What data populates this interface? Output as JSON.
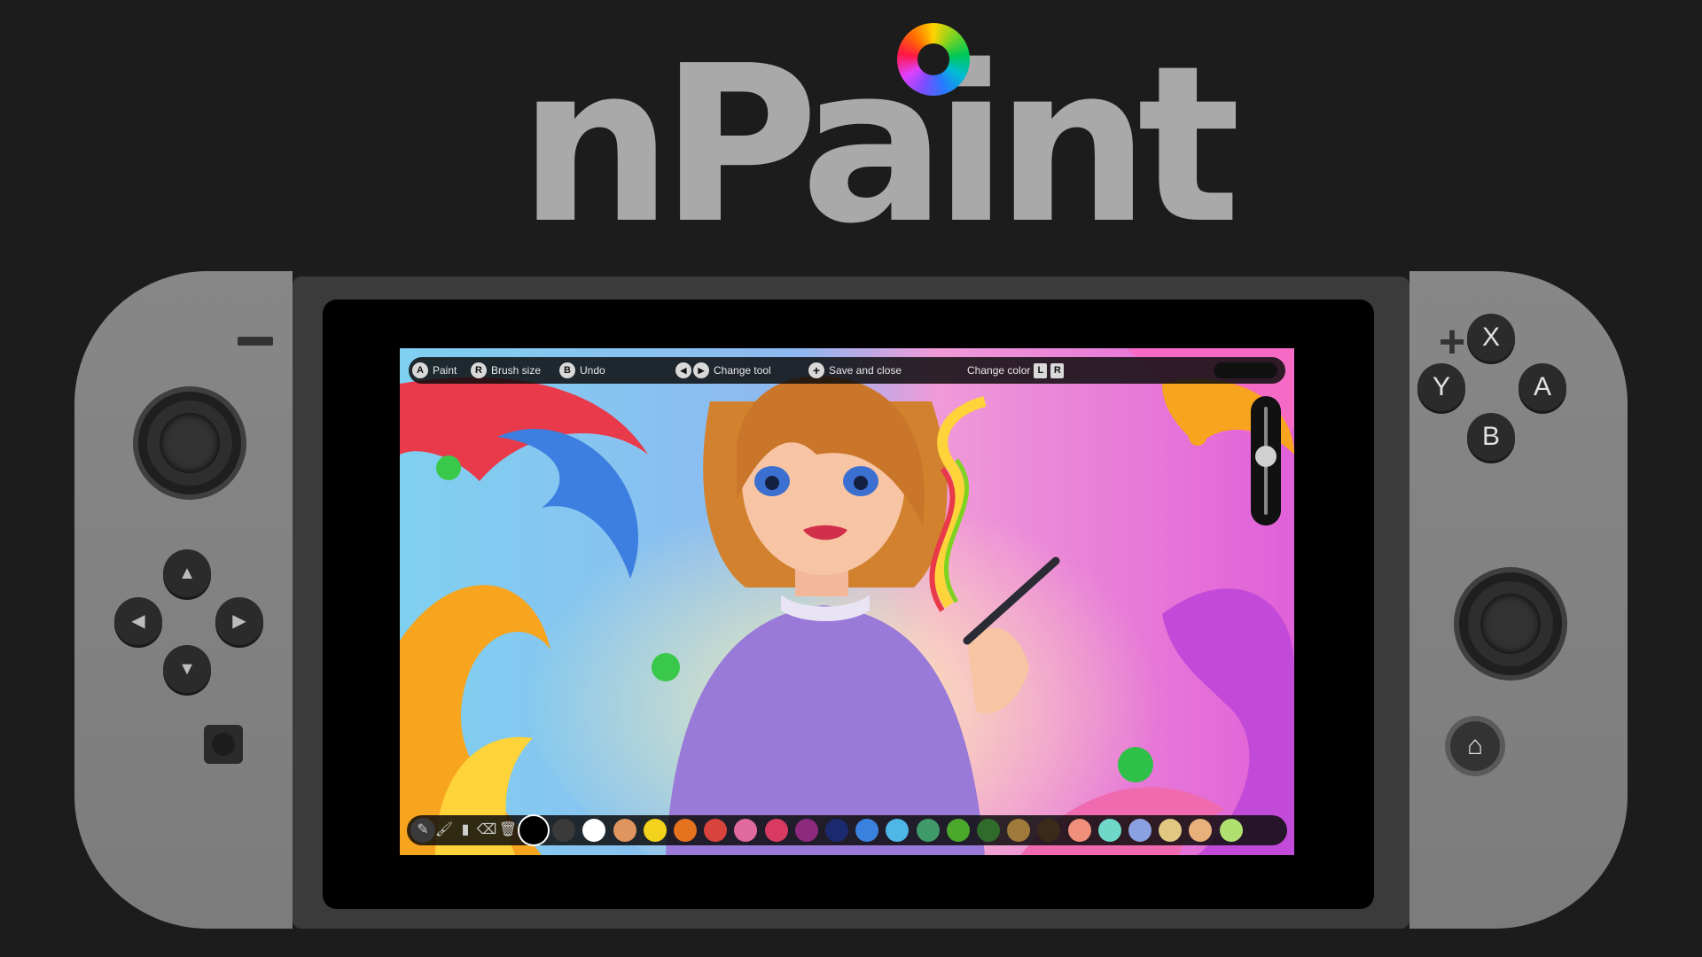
{
  "logo": {
    "text": "nPaint"
  },
  "topbar": {
    "paint": {
      "key": "A",
      "label": "Paint"
    },
    "brush_size": {
      "key": "R",
      "label": "Brush size"
    },
    "undo": {
      "key": "B",
      "label": "Undo"
    },
    "change_tool": {
      "key_left": "◀",
      "key_right": "▶",
      "label": "Change tool"
    },
    "save": {
      "key": "+",
      "label": "Save and close"
    },
    "change_color": {
      "label": "Change color",
      "key_l": "L",
      "key_r": "R"
    }
  },
  "brush_size_level": 0.55,
  "tools": [
    {
      "icon": "pencil-icon",
      "glyph": "✎",
      "active": true
    },
    {
      "icon": "brush-icon",
      "glyph": "🖌",
      "active": false
    },
    {
      "icon": "marker-icon",
      "glyph": "▮",
      "active": false
    },
    {
      "icon": "eraser-icon",
      "glyph": "⌫",
      "active": false
    },
    {
      "icon": "bucket-icon",
      "glyph": "🗑",
      "active": false
    }
  ],
  "palette": [
    "#000000",
    "#3a3a3a",
    "#ffffff",
    "#e0945e",
    "#f2d21b",
    "#e5721f",
    "#d8443c",
    "#e06a9c",
    "#d83a62",
    "#8e2a7e",
    "#1b2a6e",
    "#3b82e0",
    "#4fb6e8",
    "#3f9a6a",
    "#4aa82a",
    "#2f6b2a",
    "#a07a3a",
    "#3a2a1a",
    "#f0907a",
    "#6fd8c8",
    "#8aa0e0",
    "#e0c880",
    "#e8b07a",
    "#b0e070"
  ],
  "selected_color": 0,
  "controller": {
    "x": "X",
    "y": "Y",
    "a": "A",
    "b": "B",
    "dpad_up": "▲",
    "dpad_left": "◀",
    "dpad_right": "▶",
    "dpad_down": "▼",
    "home_glyph": "⌂",
    "plus": "+"
  }
}
